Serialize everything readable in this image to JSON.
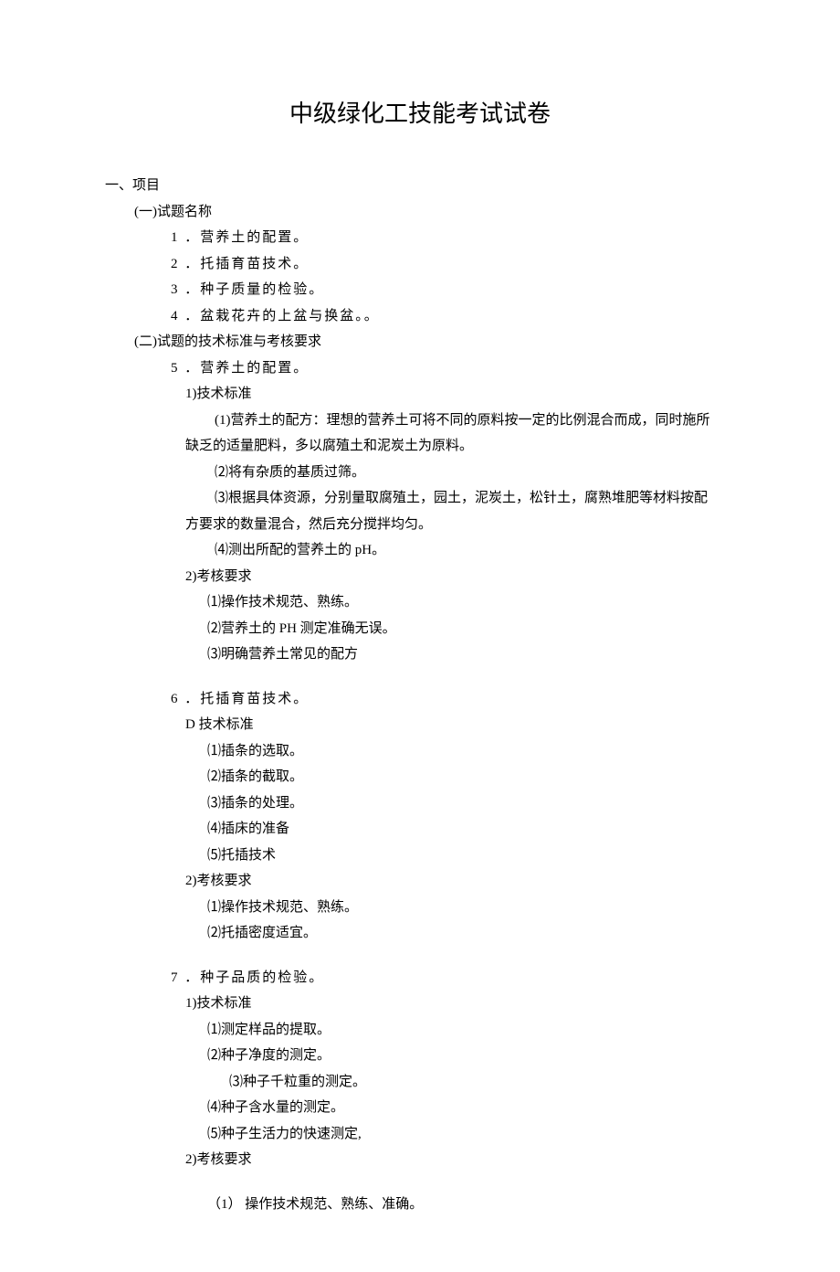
{
  "title": "中级绿化工技能考试试卷",
  "section1": {
    "heading": "一、项目",
    "sub1": {
      "heading": "(一)试题名称",
      "items": {
        "i1": "1 ．营养土的配置。",
        "i2": "2 ．托插育苗技术。",
        "i3": "3 ．种子质量的检验。",
        "i4": "4 ．盆栽花卉的上盆与换盆。。"
      }
    },
    "sub2": {
      "heading": "(二)试题的技术标准与考核要求",
      "item5": {
        "num": "5 ．营养土的配置。",
        "tech_heading": "1)技术标准",
        "t1_a": "(1)营养土的配方：理想的营养土可将不同的原料按一定的比例混合而成，同时施所",
        "t1_b": "缺乏的适量肥料，多以腐殖土和泥炭土为原料。",
        "t2": "⑵将有杂质的基质过筛。",
        "t3_a": "⑶根据具体资源，分别量取腐殖土，园土，泥炭土，松针土，腐熟堆肥等材料按配",
        "t3_b": "方要求的数量混合，然后充分搅拌均匀。",
        "t4": "⑷测出所配的营养土的 pH。",
        "exam_heading": "2)考核要求",
        "e1": "⑴操作技术规范、熟练。",
        "e2": "⑵营养土的 PH 测定准确无误。",
        "e3": "⑶明确营养土常见的配方"
      },
      "item6": {
        "num": "6 ．托插育苗技术。",
        "tech_heading": "D 技术标准",
        "t1": "⑴插条的选取。",
        "t2": "⑵插条的截取。",
        "t3": "⑶插条的处理。",
        "t4": "⑷插床的准备",
        "t5": "⑸托插技术",
        "exam_heading": "2)考核要求",
        "e1": "⑴操作技术规范、熟练。",
        "e2": "⑵托插密度适宜。"
      },
      "item7": {
        "num": "7 ．种子品质的检验。",
        "tech_heading": "1)技术标准",
        "t1": "⑴测定样品的提取。",
        "t2": "⑵种子净度的测定。",
        "t3": "⑶种子千粒重的测定。",
        "t4": "⑷种子含水量的测定。",
        "t5": "⑸种子生活力的快速测定,",
        "exam_heading": "2)考核要求",
        "e1": "（1） 操作技术规范、熟练、准确。"
      }
    }
  }
}
